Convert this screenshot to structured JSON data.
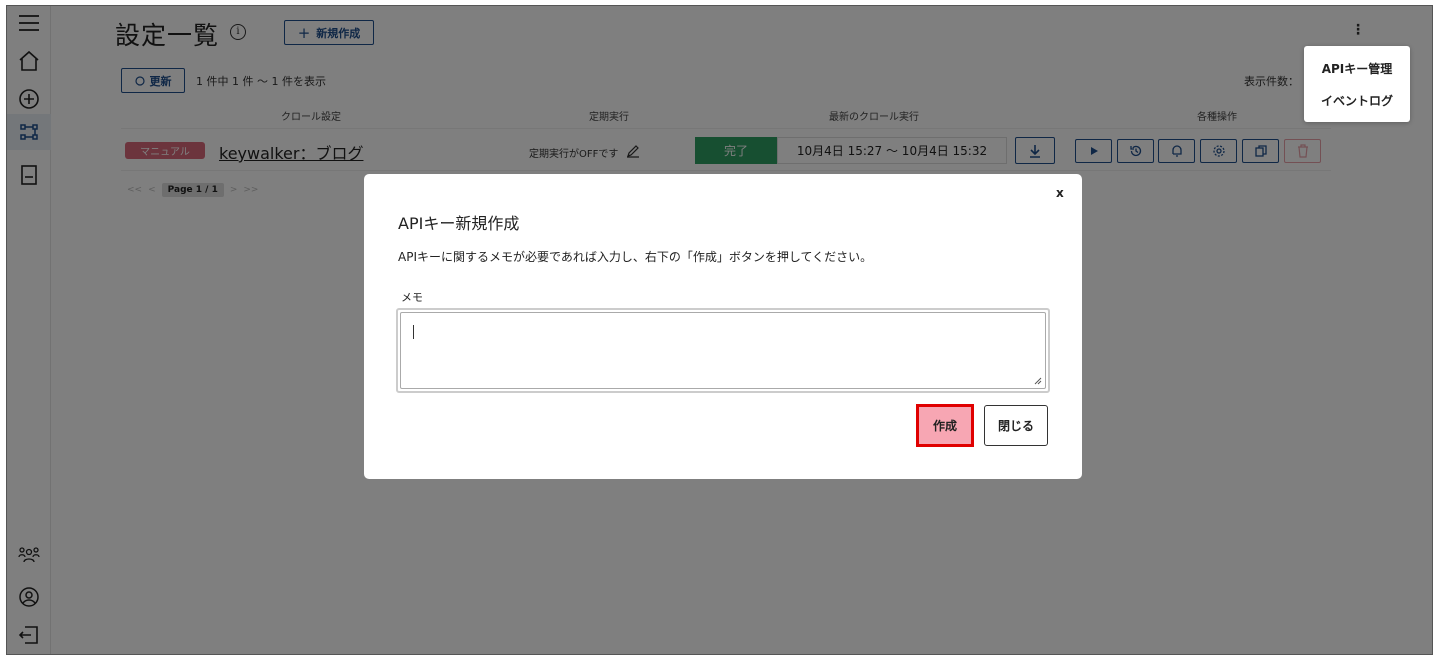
{
  "page": {
    "title": "設定一覧",
    "new_button": "新規作成",
    "refresh_button": "更新",
    "count_text": "1 件中 1 件 ～ 1 件を表示",
    "per_page_label": "表示件数：",
    "kebab": "⋮",
    "menu": [
      "APIキー管理",
      "イベントログ"
    ],
    "columns": [
      "クロール設定",
      "定期実行",
      "最新のクロール実行",
      "各種操作"
    ]
  },
  "row": {
    "badge": "マニュアル",
    "name": "keywalker：ブログ",
    "schedule": "定期実行がOFFです",
    "status": "完了",
    "range": "10月4日 15:27 ～ 10月4日 15:32"
  },
  "pager": {
    "first": "<<",
    "prev": "<",
    "page": "Page 1 / 1",
    "next": ">",
    "last": ">>"
  },
  "modal": {
    "close": "x",
    "title": "APIキー新規作成",
    "description": "APIキーに関するメモが必要であれば入力し、右下の「作成」ボタンを押してください。",
    "memo_label": "メモ",
    "memo_value": "",
    "create_button": "作成",
    "close_button": "閉じる"
  },
  "colors": {
    "primary": "#1f4e8c",
    "badge": "#d9697a",
    "status_done": "#2e9e63",
    "create_fill": "#f7a6b3",
    "highlight": "#e00000"
  },
  "icons": [
    "menu-icon",
    "home-icon",
    "add-circle-icon",
    "flow-icon",
    "document-icon",
    "users-icon",
    "account-icon",
    "logout-icon"
  ]
}
